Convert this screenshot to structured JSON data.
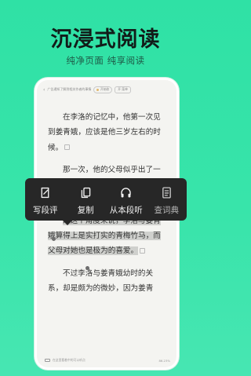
{
  "promo": {
    "title": "沉浸式阅读",
    "subtitle": "纯净页面  纯享阅读"
  },
  "reader": {
    "top_bar": {
      "back_symbol": "‹",
      "caption": "广告通知了解到相关作者的事情",
      "pill_left": "开始收",
      "pill_right": "开·菜单"
    },
    "paragraphs": [
      {
        "text": "在李洛的记忆中，他第一次见到姜青娥，应该是他三岁左右的时候。"
      },
      {
        "text": "那一次，他的父母似乎出了一趟很远的远门，回来后身边就多了一个粉雕玉琢般的小女孩。"
      }
    ],
    "highlight_paragraph": "从这个角度来说，李洛与姜青娥算得上是实打实的青梅竹马，而父母对她也是极为的喜爱。",
    "last_paragraph": "不过李洛与姜青娥幼时的关系，却是颇为的微妙，因为姜青",
    "bottom_bar": {
      "left_text": "在这里看着中的可以听点",
      "right_text": "86.23%"
    }
  },
  "popup_menu": {
    "items": [
      {
        "label": "写段评",
        "icon": "edit-icon"
      },
      {
        "label": "复制",
        "icon": "copy-icon"
      },
      {
        "label": "从本段听",
        "icon": "headphones-icon"
      },
      {
        "label": "查词典",
        "icon": "dictionary-icon"
      }
    ]
  },
  "colors": {
    "background_accent": "#38e4aa",
    "popup_bg": "#272727",
    "highlight": "#cfd0cd"
  }
}
